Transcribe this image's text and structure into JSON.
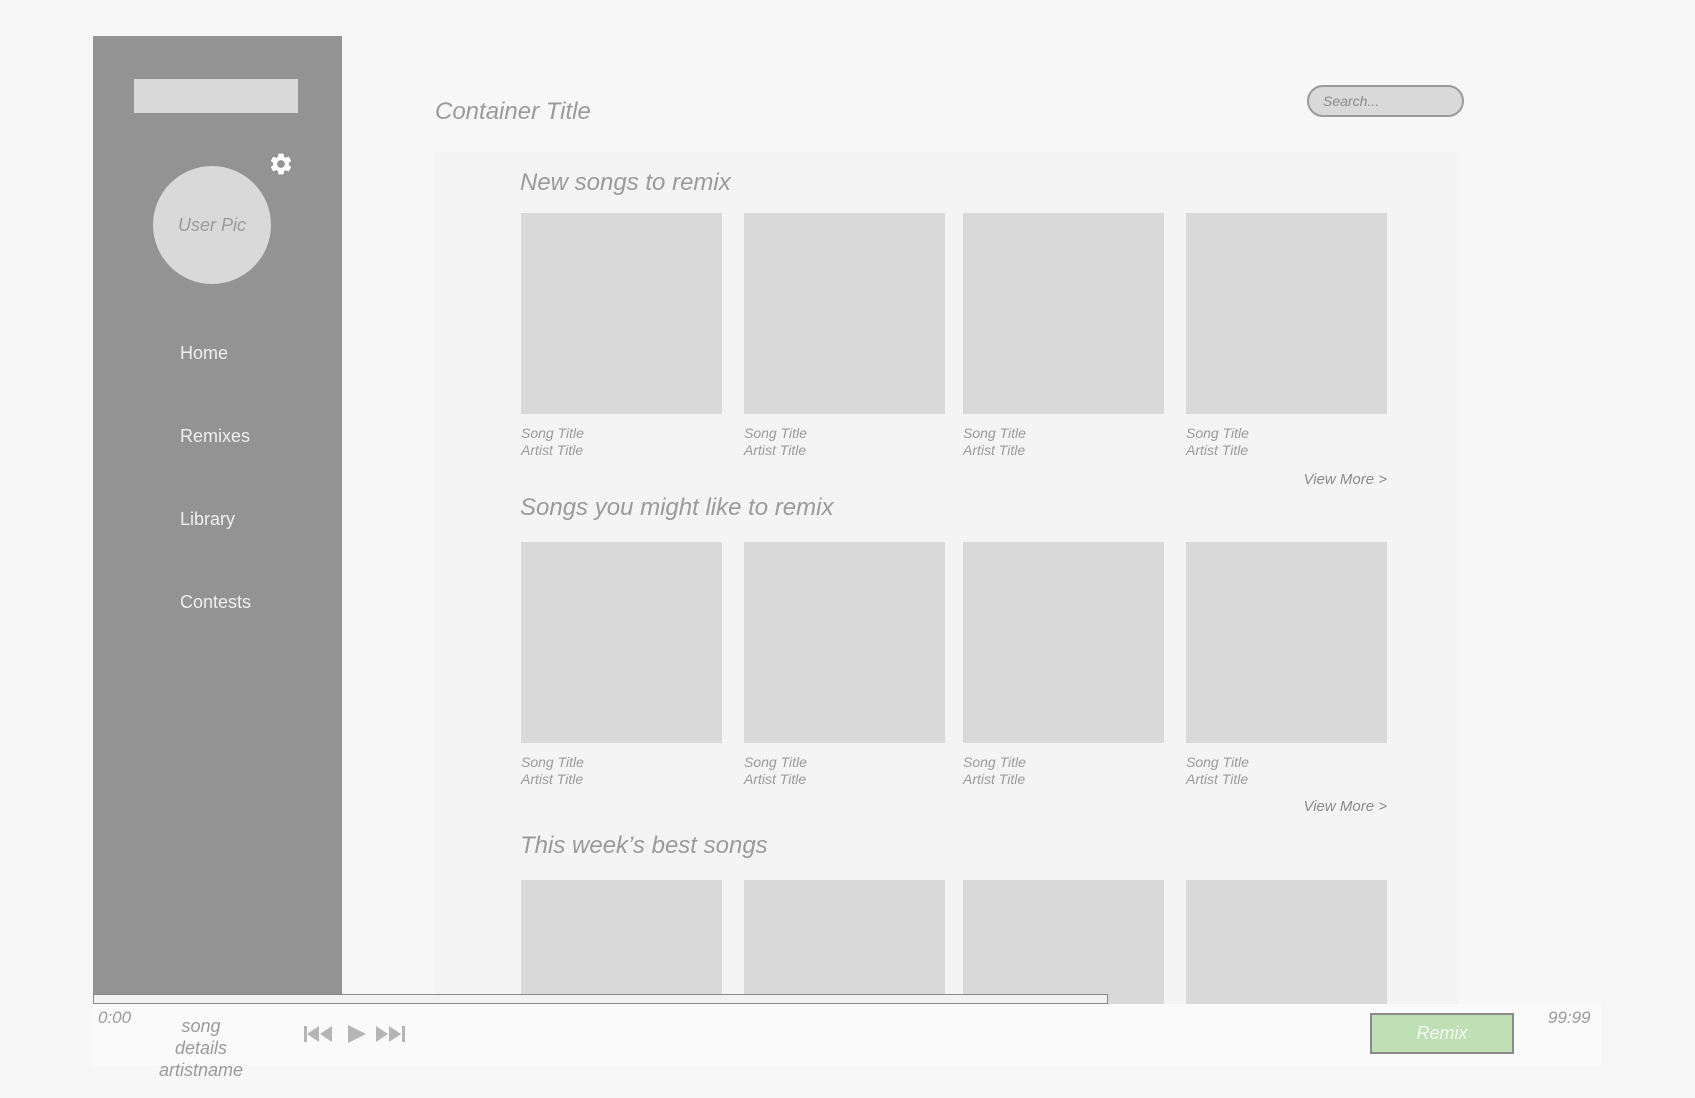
{
  "sidebar": {
    "avatar_label": "User Pic",
    "nav": [
      {
        "label": "Home"
      },
      {
        "label": "Remixes"
      },
      {
        "label": "Library"
      },
      {
        "label": "Contests"
      }
    ],
    "settings_icon": "gear-icon"
  },
  "header": {
    "title": "Container Title",
    "search_placeholder": "Search..."
  },
  "sections": [
    {
      "title": "New songs to remix",
      "cards": [
        {
          "song": "Song Title",
          "artist": "Artist Title"
        },
        {
          "song": "Song Title",
          "artist": "Artist Title"
        },
        {
          "song": "Song Title",
          "artist": "Artist Title"
        },
        {
          "song": "Song Title",
          "artist": "Artist Title"
        }
      ],
      "view_more": "View More >"
    },
    {
      "title": "Songs you might like to remix",
      "cards": [
        {
          "song": "Song Title",
          "artist": "Artist Title"
        },
        {
          "song": "Song Title",
          "artist": "Artist Title"
        },
        {
          "song": "Song Title",
          "artist": "Artist Title"
        },
        {
          "song": "Song Title",
          "artist": "Artist Title"
        }
      ],
      "view_more": "View More >"
    },
    {
      "title": "This week’s best songs",
      "cards": [
        {
          "song": "",
          "artist": ""
        },
        {
          "song": "",
          "artist": ""
        },
        {
          "song": "",
          "artist": ""
        },
        {
          "song": "",
          "artist": ""
        }
      ],
      "view_more": ""
    }
  ],
  "player": {
    "current_time": "0:00",
    "end_time": "99:99",
    "song_details": "song details",
    "artist_name": "artistname",
    "remix_label": "Remix",
    "progress": 0.62,
    "icons": [
      "skip-back-icon",
      "play-icon",
      "skip-forward-icon"
    ],
    "remix_color": "#bfe0b5"
  }
}
